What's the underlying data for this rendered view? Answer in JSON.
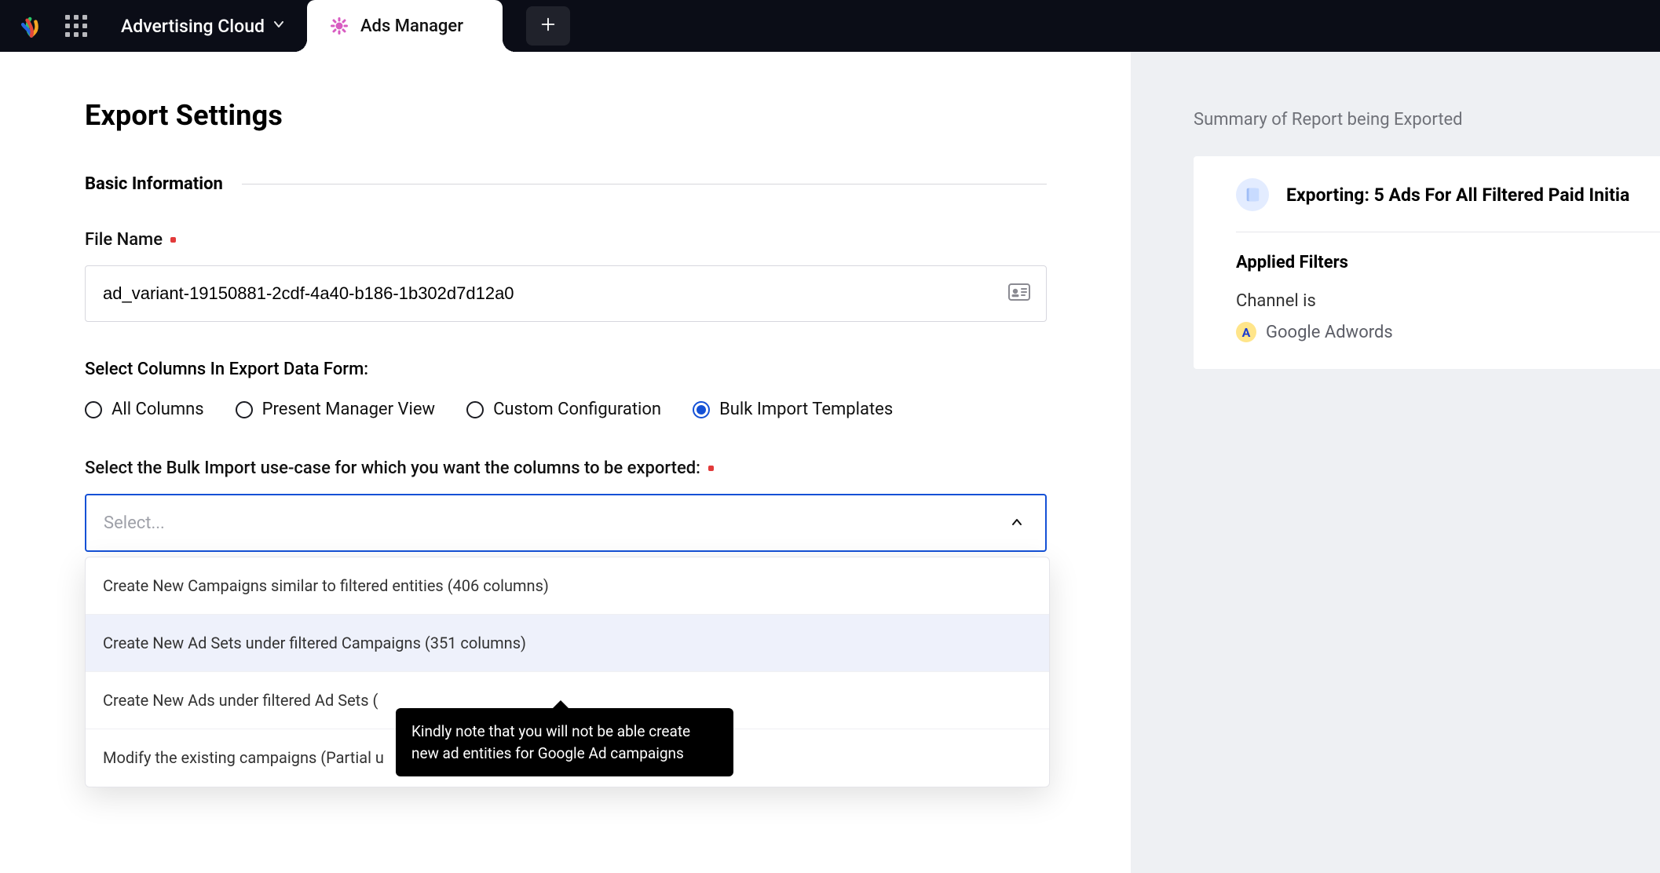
{
  "topbar": {
    "cloud_label": "Advertising Cloud",
    "active_tab_label": "Ads Manager"
  },
  "page": {
    "title": "Export Settings",
    "basic_info_label": "Basic Information",
    "file_name_label": "File Name",
    "file_name_value": "ad_variant-19150881-2cdf-4a40-b186-1b302d7d12a0",
    "columns_label": "Select Columns In Export Data Form:",
    "radio_options": {
      "all": "All Columns",
      "present": "Present Manager View",
      "custom": "Custom Configuration",
      "bulk": "Bulk Import Templates"
    },
    "usecase_label": "Select the Bulk Import use-case for which you want the columns to be exported:",
    "select_placeholder": "Select...",
    "dropdown": [
      "Create New Campaigns similar to filtered entities (406 columns)",
      "Create New Ad Sets under filtered Campaigns (351 columns)",
      "Create New Ads under filtered Ad Sets (",
      "Modify the existing campaigns (Partial u"
    ],
    "tooltip": "Kindly note that you will not be able create new ad entities for Google Ad campaigns"
  },
  "summary": {
    "title": "Summary of Report being Exported",
    "card_title": "Exporting: 5 Ads For All Filtered Paid Initia",
    "filters_label": "Applied Filters",
    "filter_1": "Channel is",
    "channel_name": "Google Adwords"
  }
}
